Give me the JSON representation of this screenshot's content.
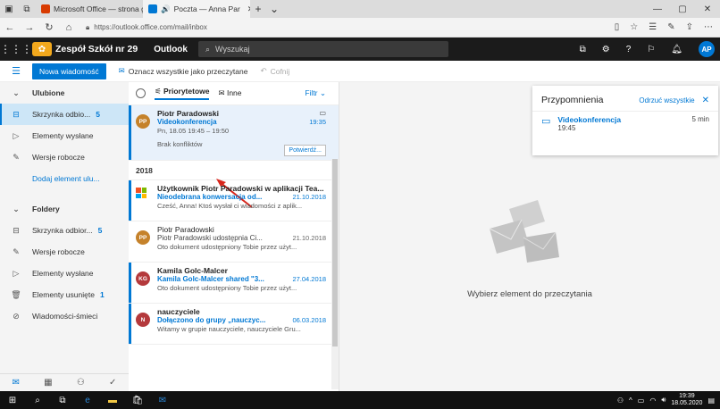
{
  "browser": {
    "tabs": [
      {
        "title": "Microsoft Office — strona g",
        "color": "#d83b01"
      },
      {
        "title": "Poczta — Anna Par",
        "color": "#0078d4",
        "audio": "🔊"
      }
    ],
    "url": "https://outlook.office.com/mail/inbox"
  },
  "header": {
    "org_name": "Zespół Szkół nr 29",
    "app_name": "Outlook",
    "search_placeholder": "Wyszukaj",
    "avatar_initials": "AP"
  },
  "commands": {
    "new_message": "Nowa wiadomość",
    "mark_all_read": "Oznacz wszystkie jako przeczytane",
    "undo": "Cofnij"
  },
  "leftnav": {
    "favorites": "Ulubione",
    "inbox_fav": {
      "label": "Skrzynka odbio...",
      "count": "5"
    },
    "sent_fav": "Elementy wysłane",
    "drafts_fav": "Wersje robocze",
    "add_item": "Dodaj element ulu...",
    "folders": "Foldery",
    "inbox": {
      "label": "Skrzynka odbior...",
      "count": "5"
    },
    "drafts": "Wersje robocze",
    "sent": "Elementy wysłane",
    "deleted": {
      "label": "Elementy usunięte",
      "count": "1"
    },
    "junk": "Wiadomości-śmieci"
  },
  "filters": {
    "focused": "Priorytetowe",
    "other": "Inne",
    "filter": "Filtr"
  },
  "messages": {
    "m1": {
      "initials": "PP",
      "sender": "Piotr Paradowski",
      "subject": "Videokonferencja",
      "time": "19:35",
      "when": "Pn, 18.05 19:45 – 19:50",
      "preview": "Brak konfliktów",
      "confirm": "Potwierdź..."
    },
    "group": "2018",
    "m2": {
      "sender": "Użytkownik Piotr Paradowski w aplikacji Tea...",
      "subject": "Nieodebrana konwersacja od...",
      "time": "21.10.2018",
      "preview": "Cześć, Anna! Ktoś wysłał ci wiadomości z aplik..."
    },
    "m3": {
      "initials": "PP",
      "sender": "Piotr Paradowski",
      "subject": "Piotr Paradowski udostępnia Ci...",
      "time": "21.10.2018",
      "preview": "Oto dokument udostępniony Tobie przez użyt..."
    },
    "m4": {
      "initials": "KG",
      "sender": "Kamila Golc-Malcer",
      "subject": "Kamila Golc-Malcer shared \"3...",
      "time": "27.04.2018",
      "preview": "Oto dokument udostępniony Tobie przez użyt..."
    },
    "m5": {
      "initials": "N",
      "sender": "nauczyciele",
      "subject": "Dołączono do grupy „nauczyc...",
      "time": "06.03.2018",
      "preview": "Witamy w grupie nauczyciele, nauczyciele Gru..."
    }
  },
  "reading_pane": {
    "empty_text": "Wybierz element do przeczytania"
  },
  "reminder": {
    "title": "Przypomnienia",
    "dismiss_all": "Odrzuć wszystkie",
    "item_name": "Videokonferencja",
    "item_time": "19:45",
    "item_due": "5 min"
  },
  "taskbar": {
    "time": "19:39",
    "date": "18.05.2020"
  }
}
